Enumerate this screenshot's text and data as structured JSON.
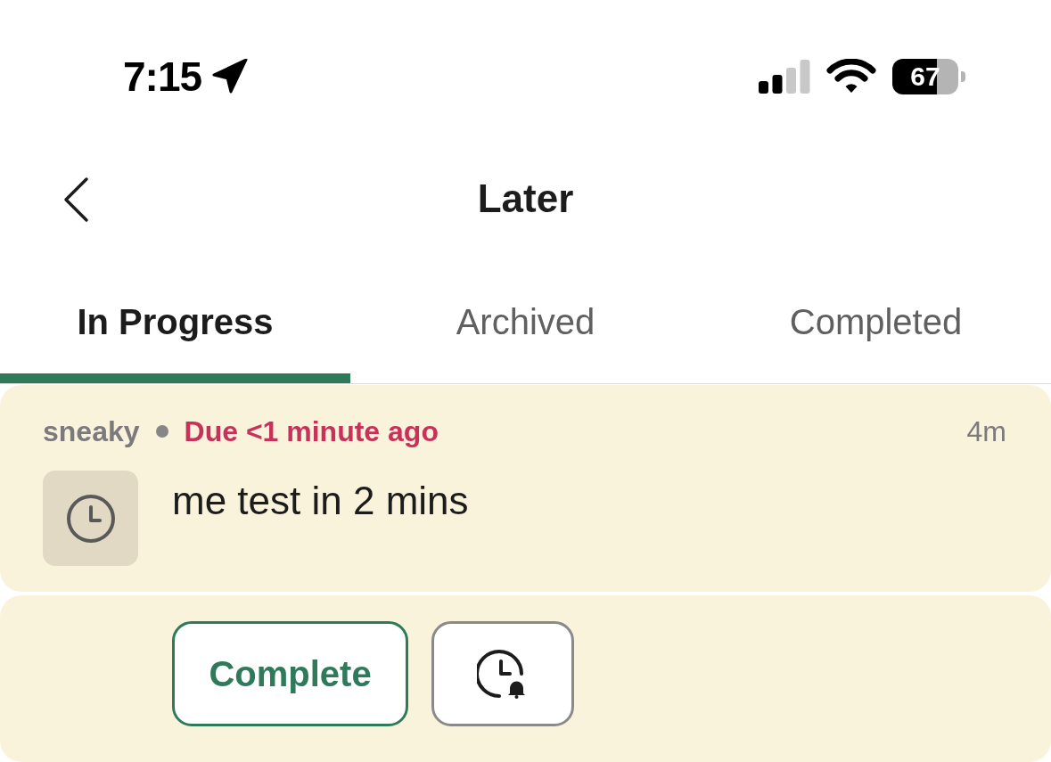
{
  "status_bar": {
    "time": "7:15",
    "battery": "67"
  },
  "nav": {
    "title": "Later"
  },
  "tabs": [
    {
      "label": "In Progress",
      "selected": true
    },
    {
      "label": "Archived",
      "selected": false
    },
    {
      "label": "Completed",
      "selected": false
    }
  ],
  "items": [
    {
      "channel": "sneaky",
      "due": "Due <1 minute ago",
      "overdue": true,
      "age": "4m",
      "text": "me test in 2 mins",
      "actions": [
        {
          "kind": "complete",
          "label": "Complete"
        },
        {
          "kind": "remind"
        }
      ]
    }
  ]
}
